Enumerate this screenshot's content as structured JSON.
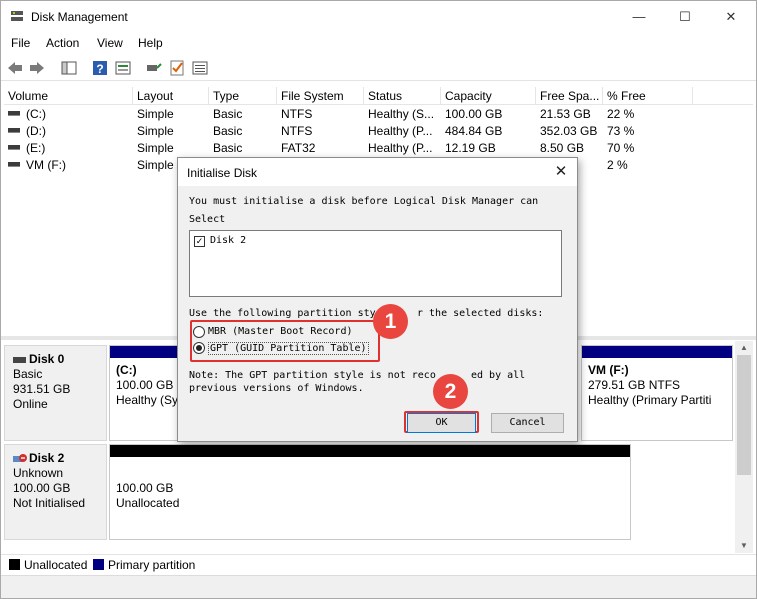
{
  "window": {
    "title": "Disk Management",
    "controls": {
      "minimize": "—",
      "maximize": "☐",
      "close": "✕"
    }
  },
  "menu": [
    "File",
    "Action",
    "View",
    "Help"
  ],
  "toolbar_icons": [
    "back-arrow-icon",
    "forward-arrow-icon",
    "console-tree-icon",
    "help-icon",
    "properties-icon",
    "connect-icon",
    "check-icon",
    "list-icon"
  ],
  "volumes": {
    "columns": [
      "Volume",
      "Layout",
      "Type",
      "File System",
      "Status",
      "Capacity",
      "Free Spa...",
      "% Free"
    ],
    "rows": [
      [
        "(C:)",
        "Simple",
        "Basic",
        "NTFS",
        "Healthy (S...",
        "100.00 GB",
        "21.53 GB",
        "22 %"
      ],
      [
        "(D:)",
        "Simple",
        "Basic",
        "NTFS",
        "Healthy (P...",
        "484.84 GB",
        "352.03 GB",
        "73 %"
      ],
      [
        "(E:)",
        "Simple",
        "Basic",
        "FAT32",
        "Healthy (P...",
        "12.19 GB",
        "8.50 GB",
        "70 %"
      ],
      [
        "VM (F:)",
        "Simple",
        "",
        "",
        "",
        "",
        "",
        "2 %"
      ]
    ]
  },
  "disks": {
    "disk0": {
      "name": "Disk 0",
      "kind": "Basic",
      "size": "931.51 GB",
      "state": "Online",
      "first_part": {
        "label": "(C:)",
        "line2": "100.00 GB NTFS",
        "line3": "Healthy (Sys"
      },
      "last_part": {
        "label": "VM  (F:)",
        "line2": "279.51 GB NTFS",
        "line3": "Healthy (Primary Partiti"
      }
    },
    "disk2": {
      "name": "Disk 2",
      "kind": "Unknown",
      "size": "100.00 GB",
      "state": "Not Initialised",
      "part": {
        "line1": "100.00 GB",
        "line2": "Unallocated"
      }
    }
  },
  "legend": {
    "items": [
      {
        "label": "Unallocated",
        "color": "#000000"
      },
      {
        "label": "Primary partition",
        "color": "#000080"
      }
    ]
  },
  "dialog": {
    "title": "Initialise Disk",
    "intro": "You must initialise a disk before Logical Disk Manager can",
    "select_label": "Select",
    "disk_item": "Disk 2",
    "partition_prompt_a": "Use the following partition sty",
    "partition_prompt_b": "r the selected disks:",
    "option_mbr": "MBR (Master Boot Record)",
    "option_gpt": "GPT (GUID Partition Table)",
    "note_line1_a": "Note: The GPT partition style is not reco",
    "note_line1_b": "ed by all",
    "note_line2": "previous versions of Windows.",
    "ok_label": "OK",
    "cancel_label": "Cancel",
    "close": "✕"
  },
  "annotations": {
    "step1": "1",
    "step2": "2"
  },
  "colors": {
    "primary_partition": "#000080",
    "unallocated": "#000000",
    "annotation_red": "#e03131"
  }
}
